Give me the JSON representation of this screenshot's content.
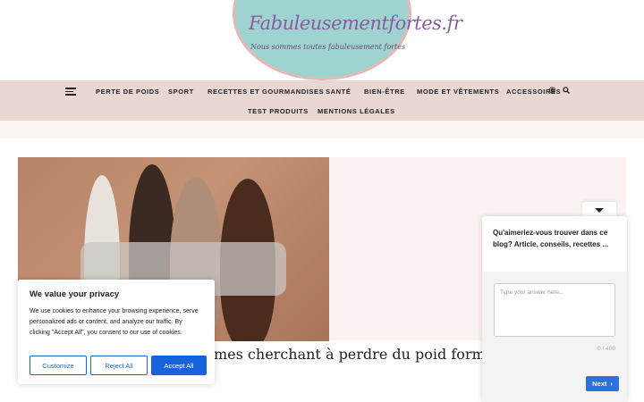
{
  "logo": {
    "title": "Fabuleusementfortes.fr",
    "tagline": "Nous sommes toutes fabuleusement fortes"
  },
  "nav": {
    "items": [
      {
        "label": "PERTE DE POIDS"
      },
      {
        "label": "SPORT"
      },
      {
        "label": "RECETTES ET GOURMANDISES"
      },
      {
        "label": "SANTÉ"
      },
      {
        "label": "BIEN-ÊTRE"
      },
      {
        "label": "MODE ET VÊTEMENTS"
      },
      {
        "label": "ACCESSOIRES"
      },
      {
        "label": "TEST PRODUITS"
      },
      {
        "label": "MENTIONS LÉGALES"
      }
    ],
    "icons": [
      "instagram-icon",
      "search-icon"
    ]
  },
  "article": {
    "title": "r les femmes cherchant à perdre du poid forme"
  },
  "cookie": {
    "heading": "We value your privacy",
    "text": "We use cookies to enhance your browsing experience, serve personalized ads or content, and analyze our traffic. By clicking \"Accept All\", you consent to our use of cookies.",
    "customize": "Customize",
    "reject": "Reject All",
    "accept": "Accept All"
  },
  "survey": {
    "question": "Qu'aimeriez-vous trouver dans ce blog? Article, conseils, recettes ...",
    "placeholder": "Type your answer here...",
    "counter": "0 / 400",
    "next": "Next"
  },
  "colors": {
    "nav_bg": "#e9d8d2",
    "accent": "#1863dc",
    "logo_teal": "#9fd3cf",
    "logo_purple": "#8a5ba3"
  }
}
